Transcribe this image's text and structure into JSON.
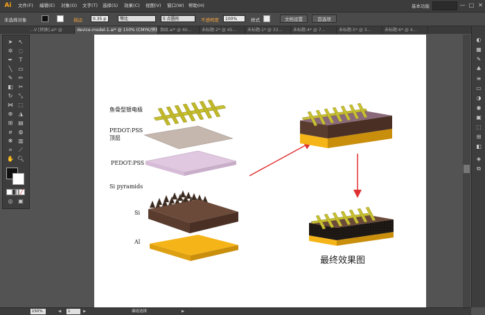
{
  "app": {
    "logo": "Ai",
    "essentials": "基本功能",
    "win_min": "—",
    "win_max": "□",
    "win_close": "✕"
  },
  "menu": [
    "文件(F)",
    "编辑(E)",
    "对象(O)",
    "文字(T)",
    "选择(S)",
    "效果(C)",
    "视图(V)",
    "窗口(W)",
    "帮助(H)"
  ],
  "control": {
    "selection": "未选择对象",
    "stroke_label": "描边",
    "stroke_value": "0.35 p",
    "uniform": "等比",
    "brush": "5 点圆形",
    "opacity_label": "不透明度",
    "opacity_value": "100%",
    "style_label": "样式",
    "doc_setup": "文档设置",
    "preferences": "首选项"
  },
  "tabs": [
    "…V [转换].ai* @",
    "device-model-1.ai* @ 150% (CMYK/预览)",
    "指纹.ai* @ 60…",
    "未标题-2* @ 45…",
    "未标题-1* @ 33…",
    "未标题-4* @ 7…",
    "未标题-5* @ 3…",
    "未标题-6* @ 4…"
  ],
  "canvas": {
    "labels": {
      "ag_electrode": "鱼骨型银电极",
      "pedot_top_1": "PEDOT:PSS",
      "pedot_top_2": "顶层",
      "pedot": "PEDOT:PSS",
      "si_pyramids": "Si pyramids",
      "si": "Si",
      "al": "Al"
    },
    "final_caption": "最终效果图"
  },
  "status": {
    "zoom": "150%",
    "page": "1",
    "tool_status": "编组选择"
  },
  "colors": {
    "ag": "#c8c030",
    "pedot_top": "#c5b7ae",
    "pedot": "#e0c8e0",
    "pyramid": "#3a2a20",
    "si": "#6b4a3a",
    "al": "#f5b418",
    "arrow": "#e03030"
  }
}
